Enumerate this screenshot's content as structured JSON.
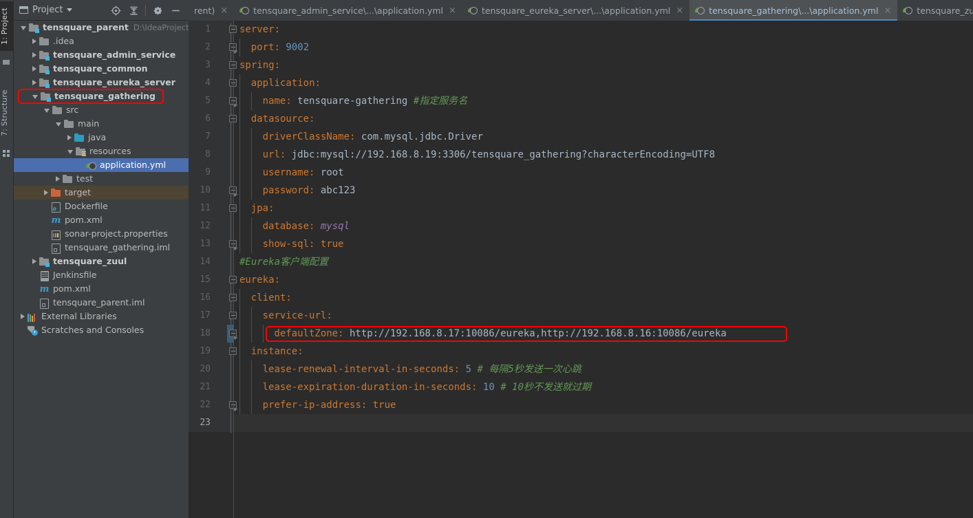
{
  "tool_stripe": {
    "tabs": [
      {
        "label": "1: Project",
        "active": true
      },
      {
        "label": "7: Structure",
        "active": false
      }
    ]
  },
  "project_panel": {
    "title": "Project",
    "icons": {
      "window": "window-icon",
      "caret": "chevron-down-icon",
      "locate": "locate-target-icon",
      "collapse": "collapse-all-icon",
      "settings": "gear-icon",
      "hide": "minimize-icon"
    },
    "tree": [
      {
        "label": "tensquare_parent",
        "sub": "D:\\IdeaProjects\\ter",
        "depth": 0,
        "arrow": "open",
        "icon": "module",
        "bold": true
      },
      {
        "label": ".idea",
        "sub": "",
        "depth": 1,
        "arrow": "closed",
        "icon": "folder",
        "bold": false
      },
      {
        "label": "tensquare_admin_service",
        "sub": "",
        "depth": 1,
        "arrow": "closed",
        "icon": "module",
        "bold": true
      },
      {
        "label": "tensquare_common",
        "sub": "",
        "depth": 1,
        "arrow": "closed",
        "icon": "module",
        "bold": true
      },
      {
        "label": "tensquare_eureka_server",
        "sub": "",
        "depth": 1,
        "arrow": "closed",
        "icon": "module",
        "bold": true
      },
      {
        "label": "tensquare_gathering",
        "sub": "",
        "depth": 1,
        "arrow": "open",
        "icon": "module",
        "bold": true,
        "annotated": true
      },
      {
        "label": "src",
        "sub": "",
        "depth": 2,
        "arrow": "open",
        "icon": "folder",
        "bold": false
      },
      {
        "label": "main",
        "sub": "",
        "depth": 3,
        "arrow": "open",
        "icon": "folder",
        "bold": false
      },
      {
        "label": "java",
        "sub": "",
        "depth": 4,
        "arrow": "closed",
        "icon": "folder-java",
        "bold": false
      },
      {
        "label": "resources",
        "sub": "",
        "depth": 4,
        "arrow": "open",
        "icon": "folder-res",
        "bold": false
      },
      {
        "label": "application.yml",
        "sub": "",
        "depth": 5,
        "arrow": "none",
        "icon": "yml",
        "bold": false,
        "selected": true
      },
      {
        "label": "test",
        "sub": "",
        "depth": 3,
        "arrow": "closed",
        "icon": "folder",
        "bold": false
      },
      {
        "label": "target",
        "sub": "",
        "depth": 2,
        "arrow": "closed",
        "icon": "folder-target",
        "bold": false,
        "highlight": "target"
      },
      {
        "label": "Dockerfile",
        "sub": "",
        "depth": 2,
        "arrow": "none",
        "icon": "docker",
        "bold": false
      },
      {
        "label": "pom.xml",
        "sub": "",
        "depth": 2,
        "arrow": "none",
        "icon": "maven",
        "bold": false
      },
      {
        "label": "sonar-project.properties",
        "sub": "",
        "depth": 2,
        "arrow": "none",
        "icon": "props",
        "bold": false
      },
      {
        "label": "tensquare_gathering.iml",
        "sub": "",
        "depth": 2,
        "arrow": "none",
        "icon": "iml",
        "bold": false
      },
      {
        "label": "tensquare_zuul",
        "sub": "",
        "depth": 1,
        "arrow": "closed",
        "icon": "module",
        "bold": true
      },
      {
        "label": "Jenkinsfile",
        "sub": "",
        "depth": 1,
        "arrow": "none",
        "icon": "jenkins",
        "bold": false
      },
      {
        "label": "pom.xml",
        "sub": "",
        "depth": 1,
        "arrow": "none",
        "icon": "maven",
        "bold": false
      },
      {
        "label": "tensquare_parent.iml",
        "sub": "",
        "depth": 1,
        "arrow": "none",
        "icon": "iml",
        "bold": false
      },
      {
        "label": "External Libraries",
        "sub": "",
        "depth": 0,
        "arrow": "closed",
        "icon": "libs",
        "bold": false
      },
      {
        "label": "Scratches and Consoles",
        "sub": "",
        "depth": 0,
        "arrow": "none",
        "icon": "scratch",
        "bold": false
      }
    ]
  },
  "editor_tabs": [
    {
      "label": "rent)",
      "active": false,
      "truncated": true,
      "has_icon": false
    },
    {
      "label": "tensquare_admin_service\\...\\application.yml",
      "active": false,
      "has_icon": true
    },
    {
      "label": "tensquare_eureka_server\\...\\application.yml",
      "active": false,
      "has_icon": true
    },
    {
      "label": "tensquare_gathering\\...\\application.yml",
      "active": true,
      "has_icon": true
    },
    {
      "label": "tensquare_zuul\\...\\application.yml",
      "active": false,
      "has_icon": true
    }
  ],
  "editor": {
    "file": "application.yml",
    "current_line": 23,
    "total_lines": 23,
    "annotations": [
      {
        "type": "red-box",
        "target": "line-18-defaultZone"
      },
      {
        "type": "red-box",
        "target": "tree-tensquare_gathering"
      }
    ],
    "lines": [
      {
        "n": 1,
        "fold": "start",
        "indent": 0,
        "tokens": [
          {
            "t": "server",
            "c": "k"
          },
          {
            "t": ":",
            "c": "k"
          }
        ]
      },
      {
        "n": 2,
        "fold": "end",
        "indent": 1,
        "tokens": [
          {
            "t": "port",
            "c": "k"
          },
          {
            "t": ": ",
            "c": "k"
          },
          {
            "t": "9002",
            "c": "num"
          }
        ]
      },
      {
        "n": 3,
        "fold": "start",
        "indent": 0,
        "tokens": [
          {
            "t": "spring",
            "c": "k"
          },
          {
            "t": ":",
            "c": "k"
          }
        ]
      },
      {
        "n": 4,
        "fold": "start",
        "indent": 1,
        "tokens": [
          {
            "t": "application",
            "c": "k"
          },
          {
            "t": ":",
            "c": "k"
          }
        ]
      },
      {
        "n": 5,
        "fold": "end",
        "indent": 2,
        "tokens": [
          {
            "t": "name",
            "c": "k"
          },
          {
            "t": ": ",
            "c": "k"
          },
          {
            "t": "tensquare-gathering",
            "c": "v"
          },
          {
            "t": " ",
            "c": "v"
          },
          {
            "t": "#指定服务名",
            "c": "cmt"
          }
        ]
      },
      {
        "n": 6,
        "fold": "start",
        "indent": 1,
        "tokens": [
          {
            "t": "datasource",
            "c": "k"
          },
          {
            "t": ":",
            "c": "k"
          }
        ]
      },
      {
        "n": 7,
        "fold": "",
        "indent": 2,
        "tokens": [
          {
            "t": "driverClassName",
            "c": "k"
          },
          {
            "t": ": ",
            "c": "k"
          },
          {
            "t": "com.mysql.jdbc.Driver",
            "c": "v"
          }
        ]
      },
      {
        "n": 8,
        "fold": "",
        "indent": 2,
        "tokens": [
          {
            "t": "url",
            "c": "k"
          },
          {
            "t": ": ",
            "c": "k"
          },
          {
            "t": "jdbc:mysql://192.168.8.19:3306/tensquare_gathering?characterEncoding=UTF8",
            "c": "v"
          }
        ]
      },
      {
        "n": 9,
        "fold": "",
        "indent": 2,
        "tokens": [
          {
            "t": "username",
            "c": "k"
          },
          {
            "t": ": ",
            "c": "k"
          },
          {
            "t": "root",
            "c": "v"
          }
        ]
      },
      {
        "n": 10,
        "fold": "end",
        "indent": 2,
        "tokens": [
          {
            "t": "password",
            "c": "k"
          },
          {
            "t": ": ",
            "c": "k"
          },
          {
            "t": "abc123",
            "c": "v"
          }
        ]
      },
      {
        "n": 11,
        "fold": "start",
        "indent": 1,
        "tokens": [
          {
            "t": "jpa",
            "c": "k"
          },
          {
            "t": ":",
            "c": "k"
          }
        ]
      },
      {
        "n": 12,
        "fold": "",
        "indent": 2,
        "tokens": [
          {
            "t": "database",
            "c": "k"
          },
          {
            "t": ": ",
            "c": "k"
          },
          {
            "t": "mysql",
            "c": "ital-v"
          }
        ]
      },
      {
        "n": 13,
        "fold": "end",
        "indent": 2,
        "tokens": [
          {
            "t": "show-sql",
            "c": "k"
          },
          {
            "t": ": ",
            "c": "k"
          },
          {
            "t": "true",
            "c": "k"
          }
        ]
      },
      {
        "n": 14,
        "fold": "",
        "indent": 0,
        "tokens": [
          {
            "t": "#Eureka客户端配置",
            "c": "cmt"
          }
        ]
      },
      {
        "n": 15,
        "fold": "start",
        "indent": 0,
        "tokens": [
          {
            "t": "eureka",
            "c": "k"
          },
          {
            "t": ":",
            "c": "k"
          }
        ]
      },
      {
        "n": 16,
        "fold": "start",
        "indent": 1,
        "tokens": [
          {
            "t": "client",
            "c": "k"
          },
          {
            "t": ":",
            "c": "k"
          }
        ]
      },
      {
        "n": 17,
        "fold": "start",
        "indent": 2,
        "tokens": [
          {
            "t": "service-url",
            "c": "k"
          },
          {
            "t": ":",
            "c": "k"
          }
        ]
      },
      {
        "n": 18,
        "fold": "end",
        "indent": 3,
        "gutter_mark": "blue",
        "boxed": true,
        "tokens": [
          {
            "t": "defaultZone",
            "c": "k"
          },
          {
            "t": ": ",
            "c": "k"
          },
          {
            "t": "http://192.168.8.17:10086/eureka,http://192.168.8.16:10086/eureka",
            "c": "v"
          }
        ]
      },
      {
        "n": 19,
        "fold": "start",
        "indent": 1,
        "tokens": [
          {
            "t": "instance",
            "c": "k"
          },
          {
            "t": ":",
            "c": "k"
          }
        ]
      },
      {
        "n": 20,
        "fold": "",
        "indent": 2,
        "tokens": [
          {
            "t": "lease-renewal-interval-in-seconds",
            "c": "k"
          },
          {
            "t": ": ",
            "c": "k"
          },
          {
            "t": "5",
            "c": "num"
          },
          {
            "t": " ",
            "c": "v"
          },
          {
            "t": "# 每隔5秒发送一次心跳",
            "c": "cmt"
          }
        ]
      },
      {
        "n": 21,
        "fold": "",
        "indent": 2,
        "tokens": [
          {
            "t": "lease-expiration-duration-in-seconds",
            "c": "k"
          },
          {
            "t": ": ",
            "c": "k"
          },
          {
            "t": "10",
            "c": "num"
          },
          {
            "t": " ",
            "c": "v"
          },
          {
            "t": "# 10秒不发送就过期",
            "c": "cmt"
          }
        ]
      },
      {
        "n": 22,
        "fold": "end",
        "indent": 2,
        "tokens": [
          {
            "t": "prefer-ip-address",
            "c": "k"
          },
          {
            "t": ": ",
            "c": "k"
          },
          {
            "t": "true",
            "c": "k"
          }
        ]
      },
      {
        "n": 23,
        "fold": "",
        "indent": 0,
        "current": true,
        "tokens": []
      }
    ]
  },
  "colors": {
    "panel_bg": "#3C3F41",
    "editor_bg": "#2B2B2B",
    "gutter_bg": "#313335",
    "selection_blue": "#4B6EAF",
    "target_olive": "#4D4434",
    "annotation_red": "#FF0000",
    "key_orange": "#CC7832",
    "value_gray": "#A9B7C6",
    "number_blue": "#6897BB",
    "comment_green": "#629755",
    "italic_purple": "#9876AA",
    "active_tab_bg": "#4E5254"
  }
}
